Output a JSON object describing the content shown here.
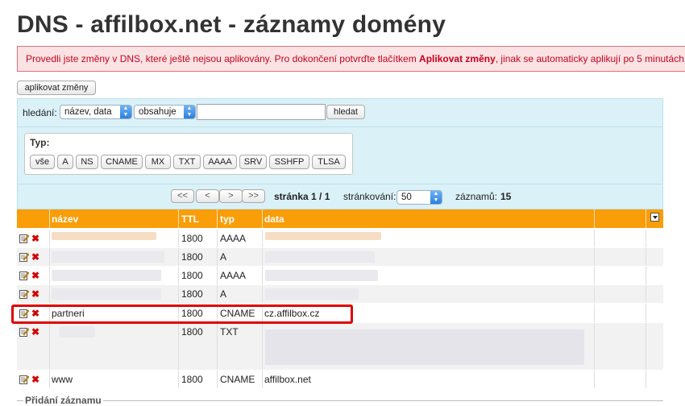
{
  "page": {
    "title": "DNS - affilbox.net - záznamy domény"
  },
  "alert": {
    "text_before": "Provedli jste změny v DNS, které ještě nejsou aplikovány. Pro dokončení potvrďte tlačítkem ",
    "action": "Aplikovat změny",
    "text_after": ", jinak se automaticky aplikují po 5 minutách."
  },
  "toolbar": {
    "apply_label": "aplikovat změny"
  },
  "search": {
    "label": "hledání:",
    "field_select": "název, data",
    "operator_select": "obsahuje",
    "query": "",
    "button": "hledat"
  },
  "types": {
    "legend": "Typ:",
    "buttons": [
      "vše",
      "A",
      "NS",
      "CNAME",
      "MX",
      "TXT",
      "AAAA",
      "SRV",
      "SSHFP",
      "TLSA"
    ]
  },
  "pager": {
    "first": "<<",
    "prev": "<",
    "next": ">",
    "last": ">>",
    "page_label": "stránka 1 / 1",
    "per_page_label": "stránkování:",
    "per_page_value": "50",
    "count_label": "záznamů:",
    "count_value": "15"
  },
  "table": {
    "headers": {
      "name": "název",
      "ttl": "TTL",
      "type": "typ",
      "data": "data"
    },
    "rows": [
      {
        "name": "",
        "ttl": "1800",
        "type": "AAAA",
        "data": ""
      },
      {
        "name": "",
        "ttl": "1800",
        "type": "A",
        "data": ""
      },
      {
        "name": "",
        "ttl": "1800",
        "type": "AAAA",
        "data": ""
      },
      {
        "name": "",
        "ttl": "1800",
        "type": "A",
        "data": ""
      },
      {
        "name": "partneri",
        "ttl": "1800",
        "type": "CNAME",
        "data": "cz.affilbox.cz"
      },
      {
        "name": "",
        "ttl": "1800",
        "type": "TXT",
        "data": ""
      },
      {
        "name": "www",
        "ttl": "1800",
        "type": "CNAME",
        "data": "affilbox.net"
      }
    ]
  },
  "add_section": {
    "legend": "Přidání záznamu"
  },
  "icons": {
    "edit": "edit-icon",
    "delete": "delete-icon",
    "menu": "column-menu-icon"
  },
  "colors": {
    "header": "#f99d08",
    "panel": "#dbf1f8",
    "alert_text": "#c8001e",
    "highlight": "#e00000"
  }
}
